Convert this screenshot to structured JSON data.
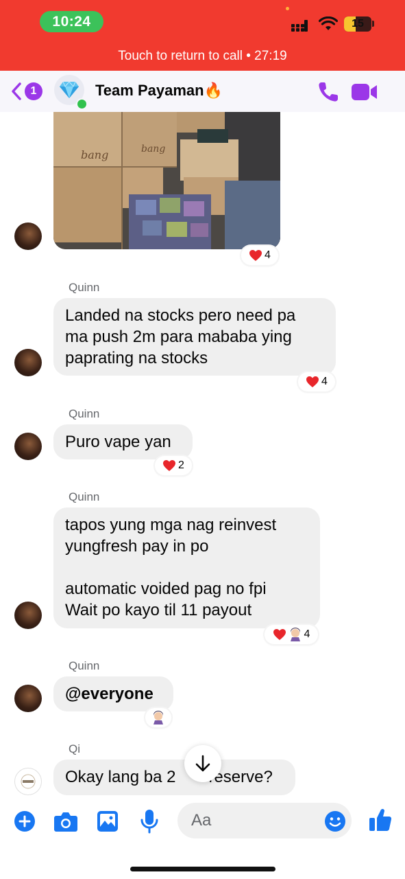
{
  "status_bar": {
    "time": "10:24",
    "battery": "15",
    "return_to_call": "Touch to return to call • 27:19"
  },
  "header": {
    "back_badge": "1",
    "title": "Team Payaman🔥"
  },
  "messages": [
    {
      "type": "image",
      "reaction_count": "4"
    },
    {
      "sender": "Quinn",
      "text": "Landed na stocks pero need pa\nma push 2m para mababa ying\npaprating na stocks",
      "reaction_count": "4"
    },
    {
      "sender": "Quinn",
      "text": "Puro vape yan",
      "reaction_count": "2"
    },
    {
      "sender": "Quinn",
      "text": "tapos yung mga nag reinvest\nyungfresh  pay in po\n\nautomatic voided pag no fpi\nWait po kayo til 11 payout",
      "reaction_count": "4"
    },
    {
      "sender": "Quinn",
      "text": "@everyone",
      "reaction_count": ""
    },
    {
      "sender": "Qi",
      "text": "Okay lang ba 2  reserve?",
      "reaction_count": ""
    }
  ],
  "composer": {
    "placeholder": "Aa"
  },
  "colors": {
    "call_bar": "#f13a2f",
    "call_pill": "#3cc25a",
    "accent": "#9b37e8",
    "composer_icon": "#1877f2",
    "bubble": "#efefef"
  },
  "icons": [
    "back-icon",
    "diamond-icon",
    "phone-icon",
    "video-camera-icon",
    "heart-icon",
    "arrow-down-icon",
    "plus-icon",
    "camera-icon",
    "gallery-icon",
    "microphone-icon",
    "emoji-icon",
    "thumbs-up-icon"
  ]
}
